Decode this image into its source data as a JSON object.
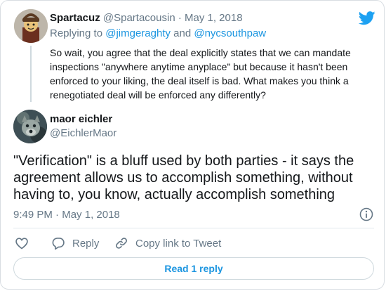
{
  "parent_tweet": {
    "display_name": "Spartacuz",
    "handle": "@Spartacousin",
    "separator": "·",
    "date": "May 1, 2018",
    "replying_prefix": "Replying to",
    "replying_user_1": "@jimgeraghty",
    "replying_conjunction": "and",
    "replying_user_2": "@nycsouthpaw",
    "text": "So wait, you agree that the deal explicitly states that we can mandate inspections \"anywhere anytime anyplace\" but because it hasn't been enforced to your liking, the deal itself is bad. What makes you think a renegotiated deal will be enforced any differently?"
  },
  "main_tweet": {
    "display_name": "maor eichler",
    "handle": "@EichlerMaor",
    "text": "\"Verification\" is a bluff used by both parties - it says the agreement allows us to accomplish something, without having to, you know, actually accomplish something",
    "time": "9:49 PM",
    "separator": "·",
    "date": "May 1, 2018"
  },
  "actions": {
    "reply_label": "Reply",
    "copy_link_label": "Copy link to Tweet"
  },
  "read_replies_label": "Read 1 reply",
  "colors": {
    "brand_blue": "#1da1f2",
    "link_blue": "#1b95e0",
    "secondary_text": "#657786",
    "primary_text": "#14171a",
    "border": "#cfd9de"
  },
  "icons": {
    "brand": "twitter-bird-icon",
    "info": "info-icon",
    "like": "heart-icon",
    "reply": "reply-bubble-icon",
    "copy_link": "link-icon"
  }
}
